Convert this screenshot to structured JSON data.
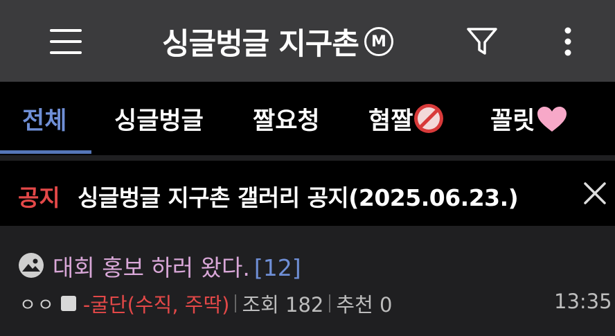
{
  "header": {
    "title": "싱글벙글 지구촌",
    "badge": "M",
    "menu_icon": "hamburger-menu-icon",
    "filter_icon": "filter-icon",
    "more_icon": "more-vertical-icon"
  },
  "tabs": [
    {
      "label": "전체",
      "active": true
    },
    {
      "label": "싱글벙글"
    },
    {
      "label": "짤요청"
    },
    {
      "label": "혐짤",
      "emoji": "no-smoking-emoji"
    },
    {
      "label": "꼴릿",
      "emoji": "pink-heart-emoji"
    }
  ],
  "notice": {
    "tag": "공지",
    "text": "싱글벙글 지구촌 갤러리 공지(2025.06.23.)",
    "close_icon": "close-icon"
  },
  "posts": [
    {
      "icon": "image-icon",
      "title": "대회 홍보 하러 왔다.",
      "comments": "[12]",
      "user_prefix": "ㅇㅇ",
      "author": "-굴단(수직, 주딱)",
      "views": "조회 182",
      "recommends": "추천 0",
      "time": "13:35"
    }
  ],
  "colors": {
    "active_tab": "#6f8fd6",
    "notice_tag": "#e34848",
    "post_title": "#d9a7d8",
    "author": "#e34848"
  }
}
